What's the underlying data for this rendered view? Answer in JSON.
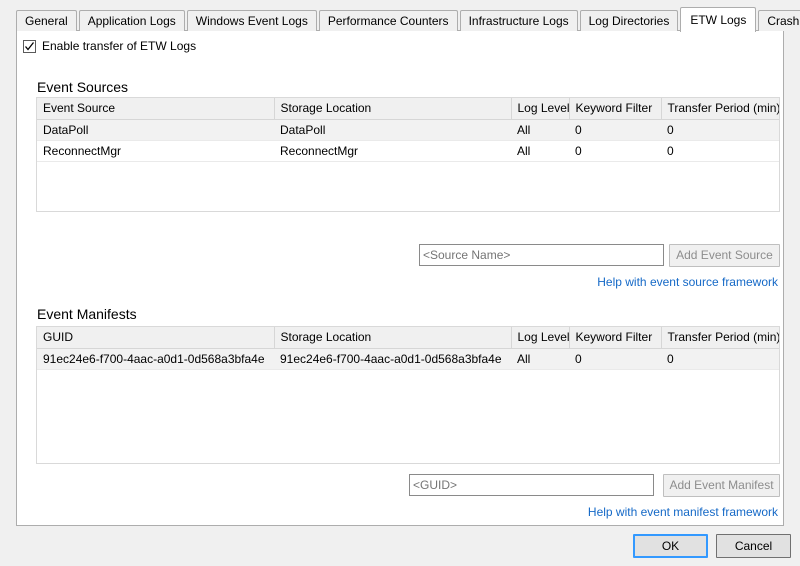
{
  "tabs": [
    {
      "label": "General",
      "active": false
    },
    {
      "label": "Application Logs",
      "active": false
    },
    {
      "label": "Windows Event Logs",
      "active": false
    },
    {
      "label": "Performance Counters",
      "active": false
    },
    {
      "label": "Infrastructure Logs",
      "active": false
    },
    {
      "label": "Log Directories",
      "active": false
    },
    {
      "label": "ETW Logs",
      "active": true
    },
    {
      "label": "Crash Dumps",
      "active": false
    }
  ],
  "enable_checkbox": {
    "label": "Enable transfer of ETW Logs",
    "checked": true
  },
  "event_sources": {
    "title": "Event Sources",
    "columns": [
      "Event Source",
      "Storage Location",
      "Log Level",
      "Keyword Filter",
      "Transfer Period (min)"
    ],
    "rows": [
      [
        "DataPoll",
        "DataPoll",
        "All",
        "0",
        "0"
      ],
      [
        "ReconnectMgr",
        "ReconnectMgr",
        "All",
        "0",
        "0"
      ]
    ],
    "input_placeholder": "<Source Name>",
    "input_value": "",
    "add_button": "Add Event Source",
    "help_link": "Help with event source framework"
  },
  "event_manifests": {
    "title": "Event Manifests",
    "columns": [
      "GUID",
      "Storage Location",
      "Log Level",
      "Keyword Filter",
      "Transfer Period (min)"
    ],
    "rows": [
      [
        "91ec24e6-f700-4aac-a0d1-0d568a3bfa4e",
        "91ec24e6-f700-4aac-a0d1-0d568a3bfa4e",
        "All",
        "0",
        "0"
      ]
    ],
    "input_placeholder": "<GUID>",
    "input_value": "",
    "add_button": "Add Event Manifest",
    "help_link": "Help with event manifest framework"
  },
  "footer": {
    "ok_label": "OK",
    "cancel_label": "Cancel"
  },
  "colors": {
    "link": "#1569c7",
    "focus_border": "#3399ff",
    "panel_bg": "#ffffff",
    "window_bg": "#f0f0f0",
    "header_bg": "#f0f0f0",
    "alt_row": "#f2f2f2"
  }
}
